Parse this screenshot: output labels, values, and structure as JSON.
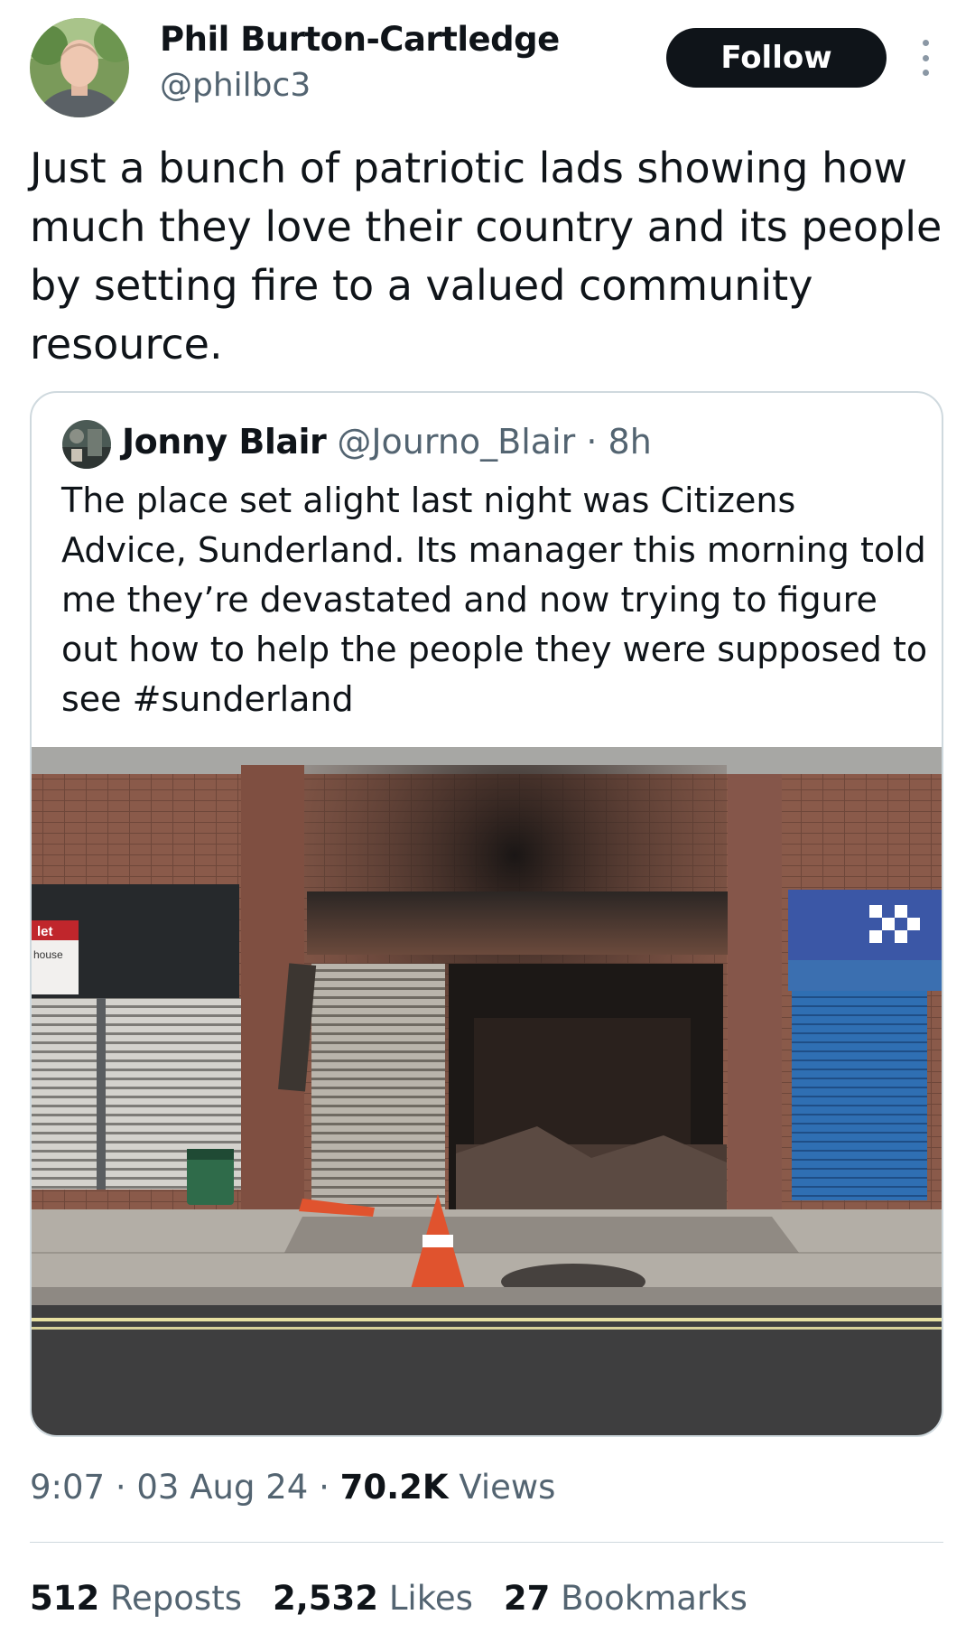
{
  "author": {
    "name": "Phil Burton-Cartledge",
    "handle": "@philbc3",
    "follow_label": "Follow"
  },
  "tweet": {
    "text": "Just a bunch of patriotic lads showing how much they love their country and its people by setting fire to a valued community resource."
  },
  "quoted_tweet": {
    "name": "Jonny Blair",
    "handle": "@Journo_Blair",
    "separator": " · ",
    "time": "8h",
    "text": "The place set alight last night was Citizens Advice, Sunderland. Its manager this morning told me they’re devastated and now trying to figure out how to help the people they were supposed to see #sunderland",
    "image_sign_text": {
      "let": "let",
      "house": "house"
    }
  },
  "meta": {
    "time": "9:07",
    "sep1": " · ",
    "date": "03 Aug 24",
    "sep2": " · ",
    "views_count": "70.2K",
    "views_label": " Views"
  },
  "stats": {
    "reposts_count": "512",
    "reposts_label": "Reposts",
    "likes_count": "2,532",
    "likes_label": "Likes",
    "bookmarks_count": "27",
    "bookmarks_label": "Bookmarks"
  },
  "colors": {
    "text": "#0f1419",
    "secondary": "#536471",
    "border": "#cfd9de",
    "button_bg": "#0f1419"
  },
  "icons": [
    "more-options-icon"
  ]
}
